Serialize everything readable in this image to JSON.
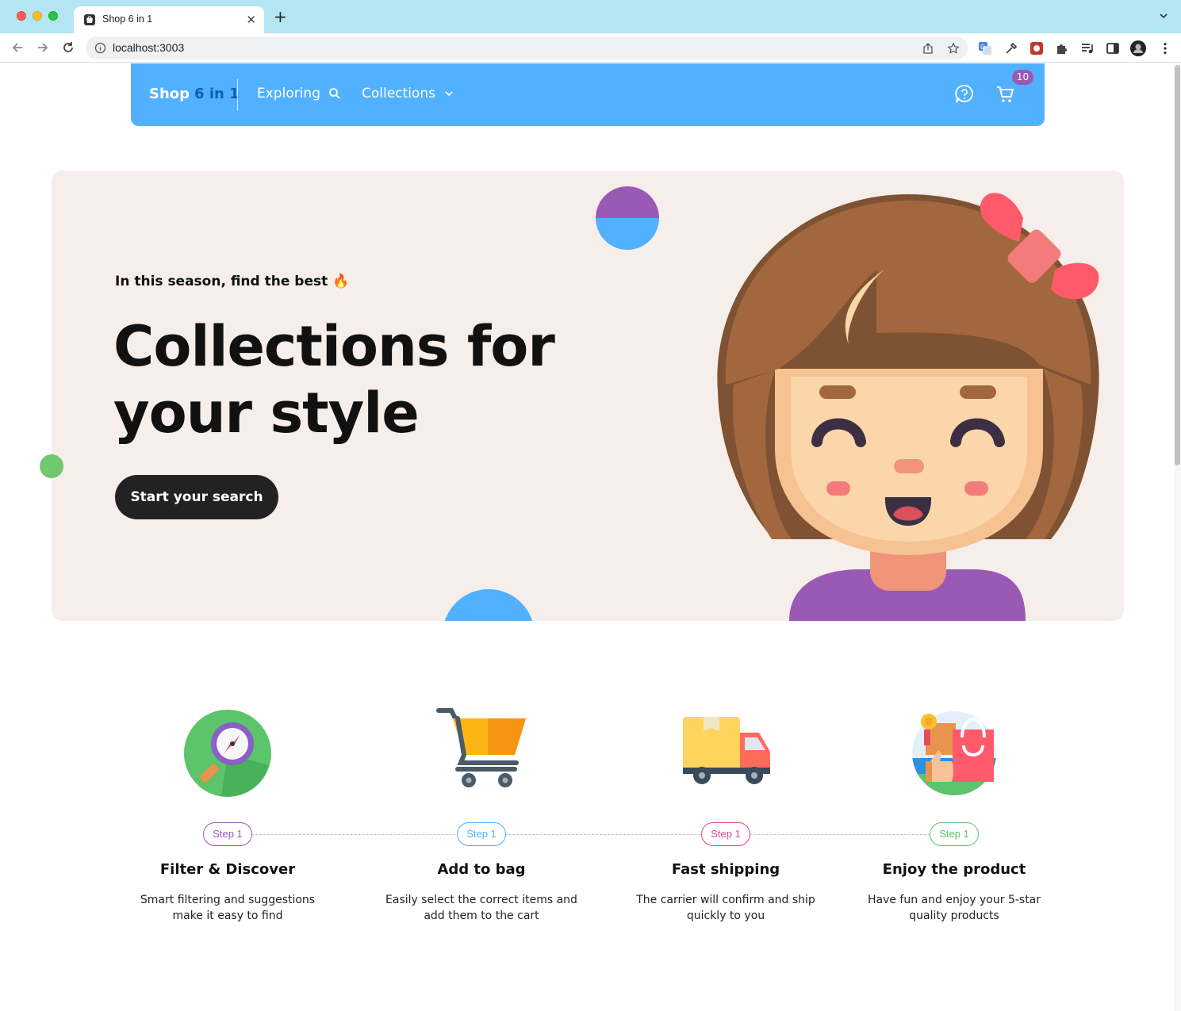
{
  "browser": {
    "tab_title": "Shop 6 in 1",
    "url": "localhost:3003",
    "icons": [
      "back-icon",
      "forward-icon",
      "reload-icon",
      "info-icon",
      "share-icon",
      "star-icon",
      "translate-icon",
      "eyedropper-icon",
      "extension-icon",
      "puzzle-icon",
      "media-icon",
      "sidepanel-icon",
      "profile-avatar",
      "more-icon"
    ]
  },
  "navbar": {
    "logo_main": "Shop",
    "logo_accent": "6 in 1",
    "explore_label": "Exploring",
    "collections_label": "Collections",
    "cart_count": "10",
    "colors": {
      "bar": "#51b1ff",
      "accent": "#0f5fb0",
      "badge": "#9b59b6"
    }
  },
  "hero": {
    "eyebrow": "In this season, find the best 🔥",
    "title": "Collections for your style",
    "cta_label": "Start your search"
  },
  "steps": [
    {
      "pill": "Step 1",
      "title": "Filter & Discover",
      "desc": "Smart filtering and suggestions make it easy to find",
      "color": "#9b59b6",
      "icon": "search-compass-icon"
    },
    {
      "pill": "Step 1",
      "title": "Add to bag",
      "desc": "Easily select the correct items and add them to the cart",
      "color": "#51b1ff",
      "icon": "shopping-cart-icon"
    },
    {
      "pill": "Step 1",
      "title": "Fast shipping",
      "desc": "The carrier will confirm and ship quickly to you",
      "color": "#e84393",
      "icon": "delivery-truck-icon"
    },
    {
      "pill": "Step 1",
      "title": "Enjoy the product",
      "desc": "Have fun and enjoy your 5-star quality products",
      "color": "#5cc46a",
      "icon": "shopping-bag-thumbs-up-icon"
    }
  ]
}
